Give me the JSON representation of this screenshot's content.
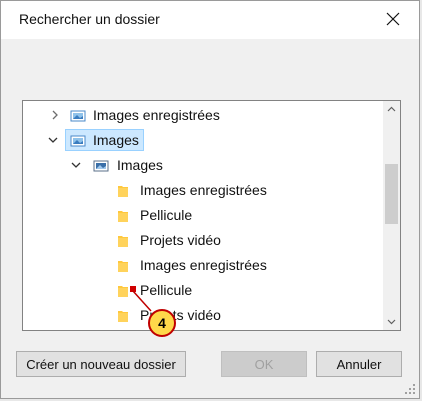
{
  "dialog": {
    "title": "Rechercher un dossier"
  },
  "tree": {
    "items": [
      {
        "label": "Images enregistrées",
        "icon": "saved-images-icon",
        "expanded": false
      },
      {
        "label": "Images",
        "icon": "library-images-icon",
        "expanded": true,
        "selected": true
      },
      {
        "label": "Images",
        "icon": "pictures-folder-icon",
        "expanded": true
      },
      {
        "label": "Images enregistrées",
        "icon": "folder-icon"
      },
      {
        "label": "Pellicule",
        "icon": "folder-icon"
      },
      {
        "label": "Projets vidéo",
        "icon": "folder-icon"
      },
      {
        "label": "Images enregistrées",
        "icon": "folder-icon"
      },
      {
        "label": "Pellicule",
        "icon": "folder-icon"
      },
      {
        "label": "Projets vidéo",
        "icon": "folder-icon"
      }
    ]
  },
  "buttons": {
    "new_folder": "Créer un nouveau dossier",
    "ok": "OK",
    "cancel": "Annuler"
  },
  "callout": {
    "number": "4"
  },
  "colors": {
    "selection_bg": "#cce8ff",
    "selection_border": "#99d1ff",
    "folder_yellow": "#ffc83d",
    "callout_fill": "#ffd84a",
    "callout_border": "#c00000"
  }
}
